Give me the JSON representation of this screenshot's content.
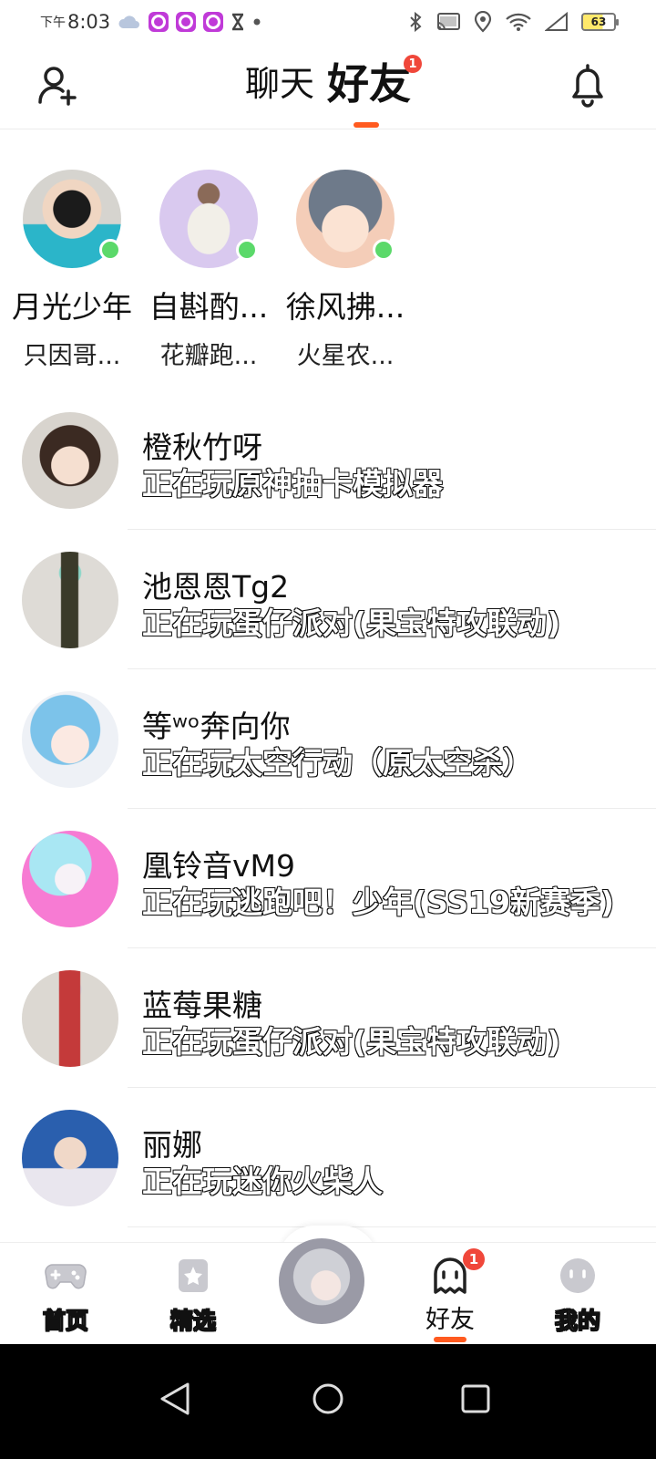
{
  "status_bar": {
    "time_prefix": "下午",
    "time": "8:03",
    "battery": "63",
    "icons": [
      "cloud-icon",
      "app-notification-icon",
      "app-notification-icon",
      "app-notification-icon",
      "hourglass-icon",
      "dot-icon",
      "bluetooth-icon",
      "cast-icon",
      "location-icon",
      "wifi-icon",
      "signal-icon",
      "battery-icon"
    ]
  },
  "header": {
    "tabs": [
      {
        "label": "聊天",
        "active": false
      },
      {
        "label": "好友",
        "active": true,
        "badge": "1"
      }
    ],
    "left_icon": "add-friend-icon",
    "right_icon": "bell-icon",
    "accent_color": "#ff5a1f"
  },
  "online_friends": [
    {
      "name": "月光少年",
      "status": "只因哥...",
      "avatar_colors": [
        "#d6d4cf",
        "#2bb5c9"
      ]
    },
    {
      "name": "自斟酌...",
      "status": "花瓣跑...",
      "avatar_colors": [
        "#d9c9ef",
        "#f2efe8"
      ]
    },
    {
      "name": "徐风拂...",
      "status": "火星农...",
      "avatar_colors": [
        "#f4cdb8",
        "#6e7a8a"
      ]
    }
  ],
  "friends": [
    {
      "name": "橙秋竹呀",
      "activity": "正在玩原神抽卡模拟器",
      "avatar_colors": [
        "#d8d4ce",
        "#3b2a22"
      ]
    },
    {
      "name": "池恩恩Tg2",
      "activity": "正在玩蛋仔派对(果宝特攻联动)",
      "avatar_colors": [
        "#dedbd6",
        "#8fd7c9"
      ]
    },
    {
      "name": "等ʷᵒ奔向你",
      "activity": "正在玩太空行动（原太空杀）",
      "avatar_colors": [
        "#eef1f6",
        "#7cc3ea"
      ]
    },
    {
      "name": "凰铃音vM9",
      "activity": "正在玩逃跑吧！少年(SS19新赛季)",
      "avatar_colors": [
        "#f77bd3",
        "#a9e7f3"
      ]
    },
    {
      "name": "蓝莓果糖",
      "activity": "正在玩蛋仔派对(果宝特攻联动)",
      "avatar_colors": [
        "#dcd8d2",
        "#c43a3a"
      ]
    },
    {
      "name": "丽娜",
      "activity": "正在玩迷你火柴人",
      "avatar_colors": [
        "#2a5fae",
        "#e9e6ee"
      ]
    }
  ],
  "bottom_nav": [
    {
      "label": "首页",
      "icon": "gamepad-icon",
      "active": false
    },
    {
      "label": "精选",
      "icon": "star-card-icon",
      "active": false
    },
    {
      "label": "",
      "icon": "user-avatar",
      "active": false
    },
    {
      "label": "好友",
      "icon": "ghost-icon",
      "active": true,
      "badge": "1"
    },
    {
      "label": "我的",
      "icon": "smile-face-icon",
      "active": false
    }
  ]
}
